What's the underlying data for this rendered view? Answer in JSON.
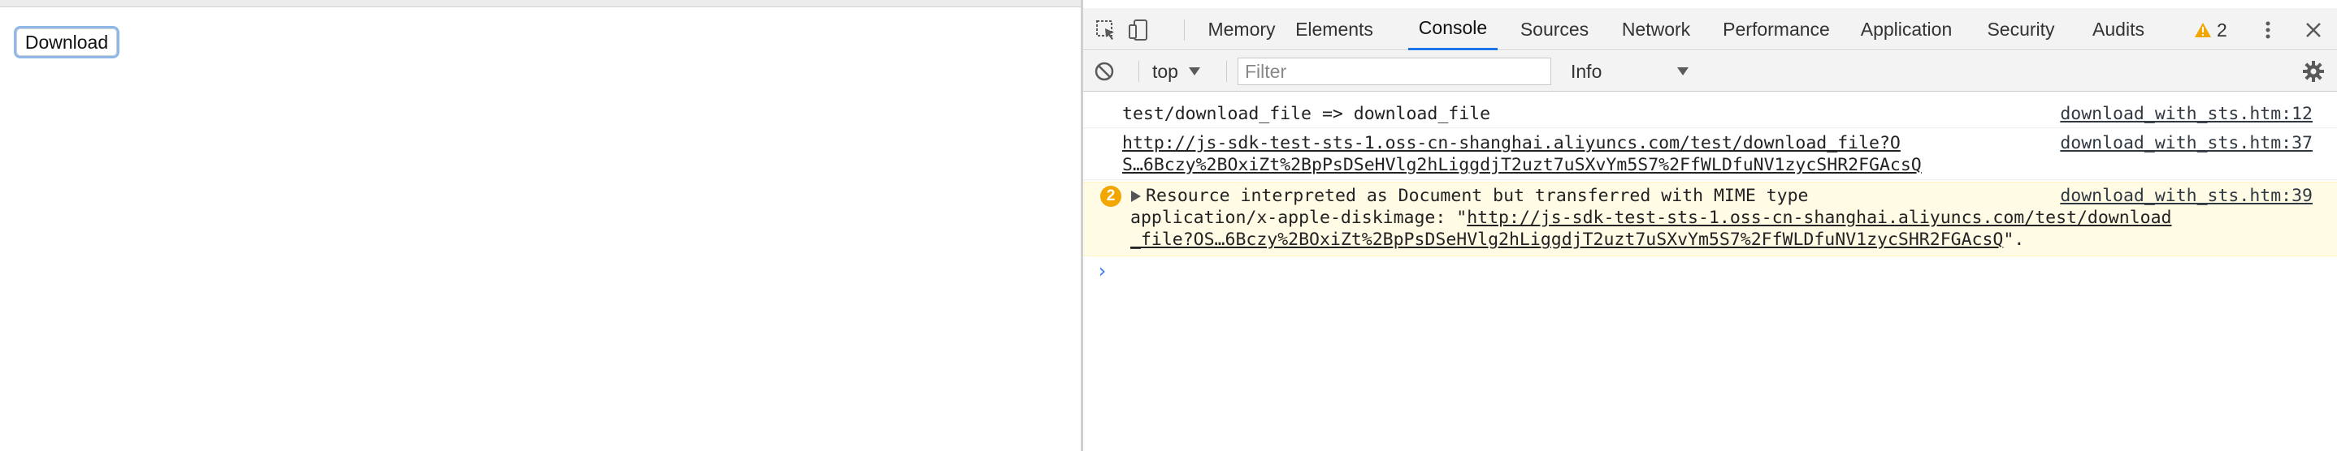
{
  "page": {
    "download_button": "Download"
  },
  "devtools": {
    "tabs": [
      "Memory",
      "Elements",
      "Console",
      "Sources",
      "Network",
      "Performance",
      "Application",
      "Security",
      "Audits"
    ],
    "active_tab": "Console",
    "warning_count": "2",
    "toolbar": {
      "context": "top",
      "filter_placeholder": "Filter",
      "level": "Info"
    },
    "messages": [
      {
        "text": "test/download_file => download_file",
        "source": "download_with_sts.htm:12"
      },
      {
        "url_line1": "http://js-sdk-test-sts-1.oss-cn-shanghai.aliyuncs.com/test/download_file?O",
        "url_line2": "S…6Bczy%2BOxiZt%2BpPsDSeHVlg2hLiggdjT2uzt7uSXvYm5S7%2FfWLDfuNV1zycSHR2FGAcsQ",
        "source": "download_with_sts.htm:37"
      },
      {
        "count": "2",
        "line1": "Resource interpreted as Document but transferred with MIME type",
        "line2_prefix": "application/x-apple-diskimage: \"",
        "url_line2": "http://js-sdk-test-sts-1.oss-cn-shanghai.aliyuncs.com/test/download",
        "url_line3": "_file?OS…6Bczy%2BOxiZt%2BpPsDSeHVlg2hLiggdjT2uzt7uSXvYm5S7%2FfWLDfuNV1zycSHR2FGAcsQ",
        "line3_suffix": "\".",
        "source": "download_with_sts.htm:39"
      }
    ],
    "colors": {
      "accent": "#1a73e8",
      "warning_bg": "#fffbe5",
      "warning_icon": "#f2a600",
      "prompt": "#367cf1"
    }
  }
}
